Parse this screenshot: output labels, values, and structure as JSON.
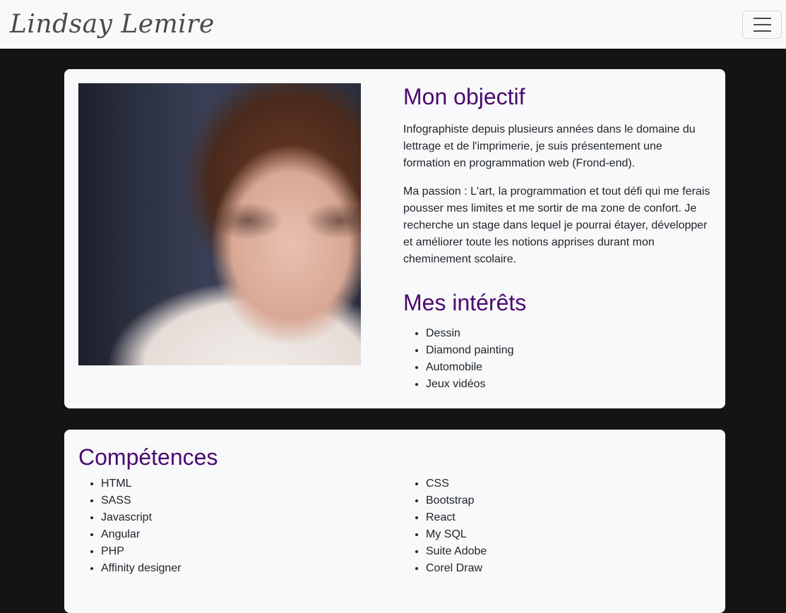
{
  "navbar": {
    "brand": "Lindsay Lemire",
    "toggler_icon": "hamburger-menu-icon"
  },
  "profile": {
    "photo_alt": "portrait-photo"
  },
  "objectif": {
    "title": "Mon objectif",
    "paragraph1": "Infographiste depuis plusieurs années dans le domaine du lettrage et de l'imprimerie, je suis présentement une formation en programmation web (Frond-end).",
    "paragraph2": "Ma passion : L'art, la programmation et tout défi qui me ferais pousser mes limites et me sortir de ma zone de confort. Je recherche un stage dans lequel je pourrai étayer, développer et améliorer toute les notions apprises durant mon cheminement scolaire."
  },
  "interets": {
    "title": "Mes intérêts",
    "items": [
      "Dessin",
      "Diamond painting",
      "Automobile",
      "Jeux vidéos"
    ]
  },
  "competences": {
    "title": "Compétences",
    "left": [
      "HTML",
      "SASS",
      "Javascript",
      "Angular",
      "PHP",
      "Affinity designer"
    ],
    "right": [
      "CSS",
      "Bootstrap",
      "React",
      "My SQL",
      "Suite Adobe",
      "Corel Draw"
    ]
  },
  "colors": {
    "background": "#141414",
    "card": "#f8f9fa",
    "heading": "#4b0a6e"
  }
}
